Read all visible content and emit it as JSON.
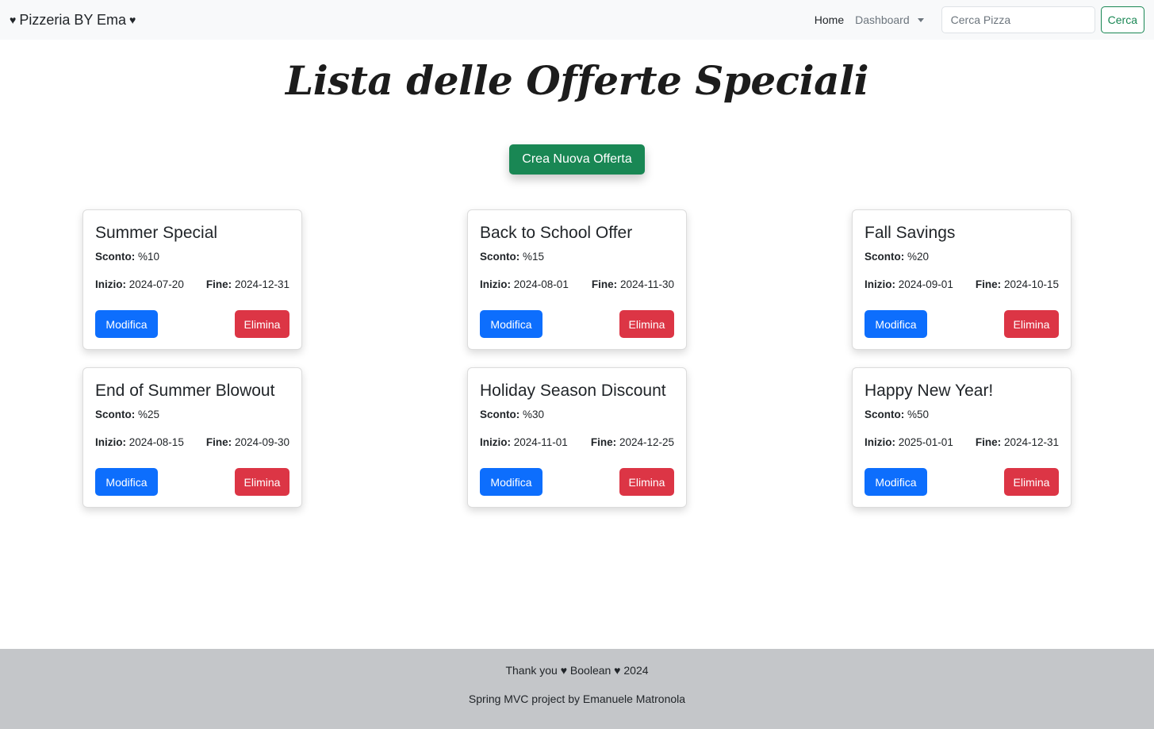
{
  "navbar": {
    "brand": "Pizzeria BY Ema",
    "heart": "♥",
    "home": "Home",
    "dashboard": "Dashboard",
    "search_placeholder": "Cerca Pizza",
    "search_button": "Cerca"
  },
  "page": {
    "title": "Lista delle Offerte Speciali",
    "create_button": "Crea Nuova Offerta"
  },
  "labels": {
    "discount": "Sconto:",
    "start": "Inizio:",
    "end": "Fine:",
    "edit": "Modifica",
    "delete": "Elimina"
  },
  "offers": [
    {
      "title": "Summer Special",
      "discount": "%10",
      "start": "2024-07-20",
      "end": "2024-12-31"
    },
    {
      "title": "Back to School Offer",
      "discount": "%15",
      "start": "2024-08-01",
      "end": "2024-11-30"
    },
    {
      "title": "Fall Savings",
      "discount": "%20",
      "start": "2024-09-01",
      "end": "2024-10-15"
    },
    {
      "title": "End of Summer Blowout",
      "discount": "%25",
      "start": "2024-08-15",
      "end": "2024-09-30"
    },
    {
      "title": "Holiday Season Discount",
      "discount": "%30",
      "start": "2024-11-01",
      "end": "2024-12-25"
    },
    {
      "title": "Happy New Year!",
      "discount": "%50",
      "start": "2025-01-01",
      "end": "2024-12-31"
    }
  ],
  "footer": {
    "line1": "Thank you ♥ Boolean ♥ 2024",
    "line2": "Spring MVC project by Emanuele Matronola"
  },
  "colors": {
    "success": "#198754",
    "primary": "#0d6efd",
    "danger": "#dc3545",
    "navbar_bg": "#f8f9fa",
    "footer_bg": "#c4c6c9"
  }
}
